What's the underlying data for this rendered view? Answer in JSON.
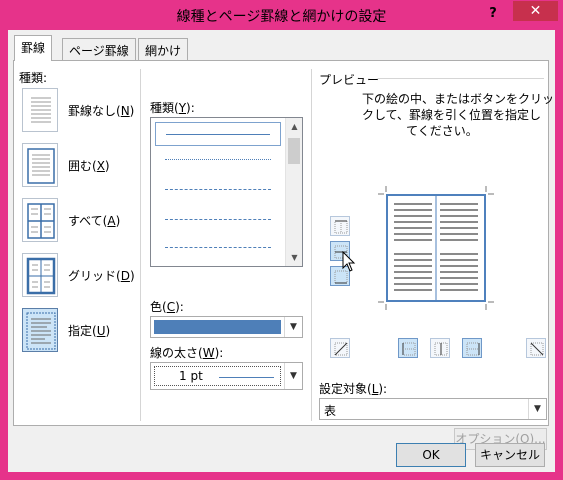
{
  "window": {
    "title": "線種とページ罫線と網かけの設定",
    "help_label": "?",
    "close_label": "✕"
  },
  "tabs": [
    {
      "label": "罫線",
      "active": true
    },
    {
      "label": "ページ罫線",
      "active": false
    },
    {
      "label": "網かけ",
      "active": false
    }
  ],
  "settings": {
    "label": "種類:",
    "items": [
      {
        "label": "罫線なし(",
        "key": "N",
        "suffix": ")",
        "icon": "no-border-icon"
      },
      {
        "label": "囲む(",
        "key": "X",
        "suffix": ")",
        "icon": "box-border-icon"
      },
      {
        "label": "すべて(",
        "key": "A",
        "suffix": ")",
        "icon": "all-borders-icon"
      },
      {
        "label": "グリッド(",
        "key": "D",
        "suffix": ")",
        "icon": "grid-border-icon"
      },
      {
        "label": "指定(",
        "key": "U",
        "suffix": ")",
        "icon": "custom-border-icon",
        "selected": true
      }
    ]
  },
  "style": {
    "label_prefix": "種類(",
    "label_key": "Y",
    "label_suffix": "):",
    "line_styles": [
      "solid",
      "dotted",
      "dashed-small",
      "dashed",
      "dash-dot"
    ]
  },
  "color": {
    "label_prefix": "色(",
    "label_key": "C",
    "label_suffix": "):",
    "value": "#4e7fb8"
  },
  "width": {
    "label_prefix": "線の太さ(",
    "label_key": "W",
    "label_suffix": "):",
    "value": "1 pt"
  },
  "preview": {
    "label": "プレビュー",
    "instructions": [
      "下の絵の中、またはボタンをクリッ",
      "クして、罫線を引く位置を指定し",
      "てください。"
    ],
    "buttons": [
      "top-border-icon",
      "inside-horizontal-border-icon",
      "bottom-border-icon",
      "diagonal-down-icon",
      "left-border-icon",
      "inside-vertical-border-icon",
      "right-border-icon",
      "diagonal-up-icon"
    ]
  },
  "apply_to": {
    "label_prefix": "設定対象(",
    "label_key": "L",
    "label_suffix": "):",
    "value": "表"
  },
  "buttons": {
    "options": "オプション(O)...",
    "ok": "OK",
    "cancel": "キャンセル"
  },
  "colors": {
    "accent": "#e6338a",
    "border_line": "#4e7fb8",
    "close": "#c7304d"
  }
}
